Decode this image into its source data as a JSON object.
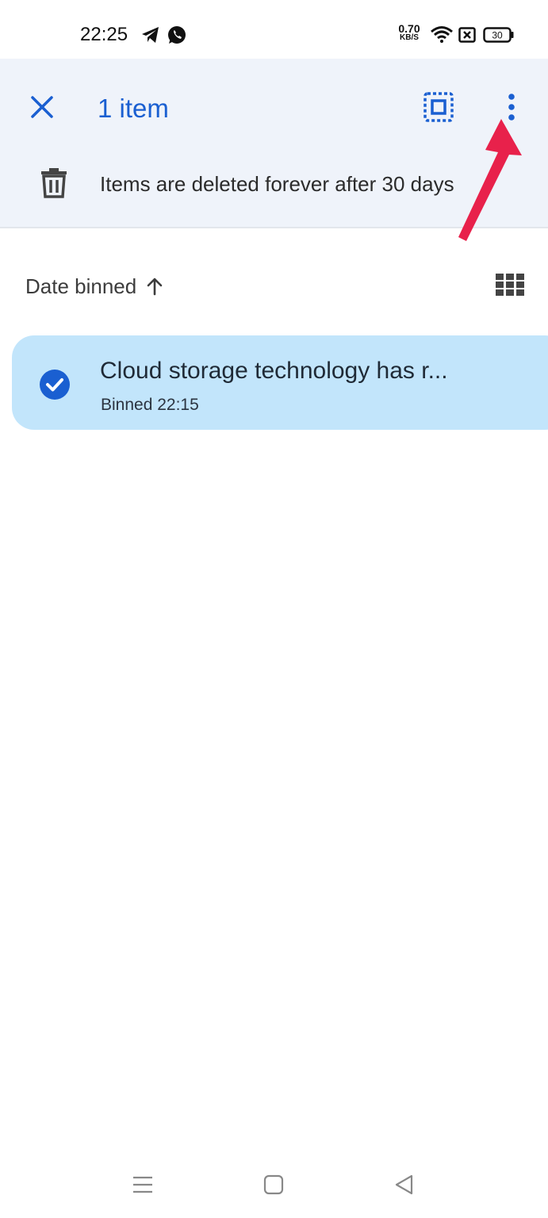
{
  "status_bar": {
    "time": "22:25",
    "net_speed_value": "0.70",
    "net_speed_unit": "KB/S",
    "battery_level": "30",
    "icons": [
      "telegram-icon",
      "whatsapp-icon",
      "wifi-icon",
      "sim-off-icon",
      "battery-icon"
    ]
  },
  "selection_bar": {
    "count_label": "1 item",
    "close_icon": "close-icon",
    "select_all_icon": "select-all-icon",
    "more_icon": "more-vertical-icon"
  },
  "bin_notice": {
    "icon": "trash-icon",
    "text": "Items are deleted forever after 30 days"
  },
  "sort": {
    "label": "Date binned",
    "direction_icon": "arrow-up-icon",
    "view_icon": "grid-view-icon"
  },
  "notes": [
    {
      "title": "Cloud storage technology has r...",
      "meta": "Binned 22:15",
      "selected": true
    }
  ],
  "colors": {
    "accent": "#1a5fd1",
    "selection_bar_bg": "#eff3fa",
    "selected_card_bg": "#c2e5fb",
    "annotation_arrow": "#e8214b"
  },
  "nav_bar": {
    "icons": [
      "menu-icon",
      "home-icon",
      "back-icon"
    ]
  }
}
